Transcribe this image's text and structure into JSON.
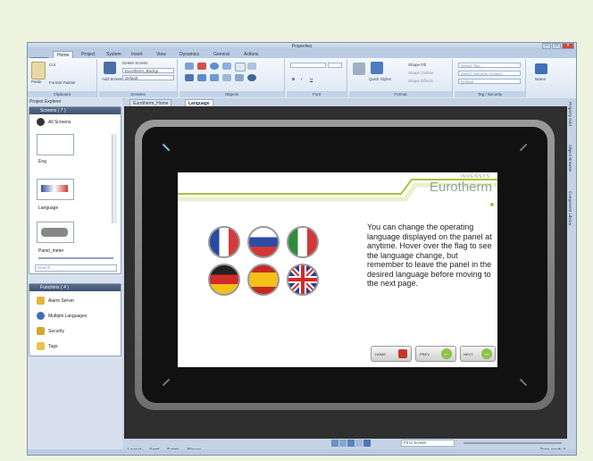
{
  "window": {
    "title": "Properties"
  },
  "menu_tabs": [
    "Home",
    "Project",
    "System",
    "Insert",
    "View",
    "Dynamics",
    "General",
    "Actions"
  ],
  "ribbon": {
    "clipboard": {
      "label": "Clipboard",
      "cut": "Cut",
      "paste": "Paste",
      "format_painter": "Format Painter"
    },
    "screens": {
      "label": "Screens",
      "add_screen": "Add Screen",
      "delete_screen": "Delete Screen",
      "background": "Eurotherm_Backgr",
      "default": "Default"
    },
    "objects": {
      "label": "Objects"
    },
    "font": {
      "label": "Font"
    },
    "format": {
      "label": "Format",
      "quick_styles": "Quick Styles",
      "shape_fill": "Shape Fill",
      "shape_outline": "Shape Outline",
      "shape_effects": "Shape Effects"
    },
    "tag_security": {
      "label": "Tag / Security",
      "select_tag": "Select Tag...",
      "select_security_groups": "Select Security Groups...",
      "default": "Default"
    },
    "name": {
      "label": "Name"
    }
  },
  "project_explorer": {
    "title": "Project Explorer",
    "screens_header": "Screens ( 7 )",
    "all_screens": "All Screens",
    "screens": [
      "Eng",
      "Language",
      "Panel_meter"
    ],
    "search_placeholder": "Search",
    "functions_header": "Functions ( 4 )",
    "functions": [
      "Alarm Server",
      "Multiple Languages",
      "Security",
      "Tags"
    ]
  },
  "doc_tabs": [
    "Eurotherm_Home",
    "Language"
  ],
  "screen": {
    "brand": "Eurotherm",
    "brand_small": "INVENSYS",
    "text": "You can change the operating language displayed on the panel at anytime. Hover over the flag to see the language change, but remember to leave the panel in the desired language before moving to the next page.",
    "flags": [
      "france-flag",
      "russia-flag",
      "italy-flag",
      "germany-flag",
      "spain-flag",
      "uk-flag"
    ],
    "buttons": {
      "home": "HOME",
      "prev": "PREV",
      "next": "NEXT"
    }
  },
  "footer": {
    "tabs": [
      "Layout",
      "Xaml",
      "Script",
      "Aliases"
    ],
    "zoom": "Fit to Screen",
    "tags_used": "Tags used: 4"
  },
  "side_tabs": [
    "Property Grid",
    "Object Browser",
    "Component Library"
  ],
  "colors": {
    "accent_green": "#a8c43a",
    "brand_green": "#8fb22c",
    "ribbon": "#dbe6f3"
  }
}
